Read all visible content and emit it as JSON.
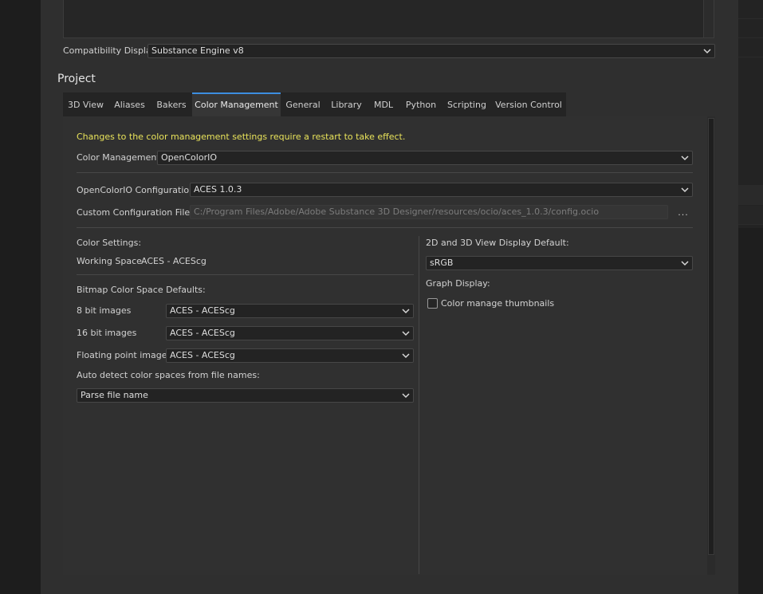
{
  "top": {
    "compatibility_label": "Compatibility Display:",
    "compatibility_value": "Substance Engine v8"
  },
  "section": {
    "title": "Project"
  },
  "tabs": [
    {
      "label": "3D View"
    },
    {
      "label": "Aliases"
    },
    {
      "label": "Bakers"
    },
    {
      "label": "Color Management",
      "active": true
    },
    {
      "label": "General"
    },
    {
      "label": "Library"
    },
    {
      "label": "MDL"
    },
    {
      "label": "Python"
    },
    {
      "label": "Scripting"
    },
    {
      "label": "Version Control"
    }
  ],
  "color_management": {
    "warning": "Changes to the color management settings require a restart to take effect.",
    "mode_label": "Color Management",
    "mode_value": "OpenColorIO",
    "ocio_config_label": "OpenColorIO Configuration",
    "ocio_config_value": "ACES 1.0.3",
    "custom_config_label": "Custom Configuration File",
    "custom_config_value": "C:/Program Files/Adobe/Adobe Substance 3D Designer/resources/ocio/aces_1.0.3/config.ocio",
    "browse_label": "...",
    "color_settings_label": "Color Settings:",
    "working_space_label": "Working Space",
    "working_space_value": "ACES - ACEScg",
    "bitmap_defaults_label": "Bitmap Color Space Defaults:",
    "bit8_label": "8 bit images",
    "bit8_value": "ACES - ACEScg",
    "bit16_label": "16 bit images",
    "bit16_value": "ACES - ACEScg",
    "float_label": "Floating point images",
    "float_value": "ACES - ACEScg",
    "auto_detect_label": "Auto detect color spaces from file names:",
    "auto_detect_value": "Parse file name",
    "display_default_label": "2D and 3D View Display Default:",
    "display_default_value": "sRGB",
    "graph_display_label": "Graph Display:",
    "thumbnails_label": "Color manage thumbnails",
    "thumbnails_checked": false
  },
  "icons": {
    "dropdown": "chevron-down-icon",
    "browse": "ellipsis-icon",
    "checkbox": "checkbox-unchecked-icon"
  },
  "colors": {
    "accent": "#3c8ee0",
    "warning": "#e9e35a",
    "panel": "#2f2f2f"
  }
}
